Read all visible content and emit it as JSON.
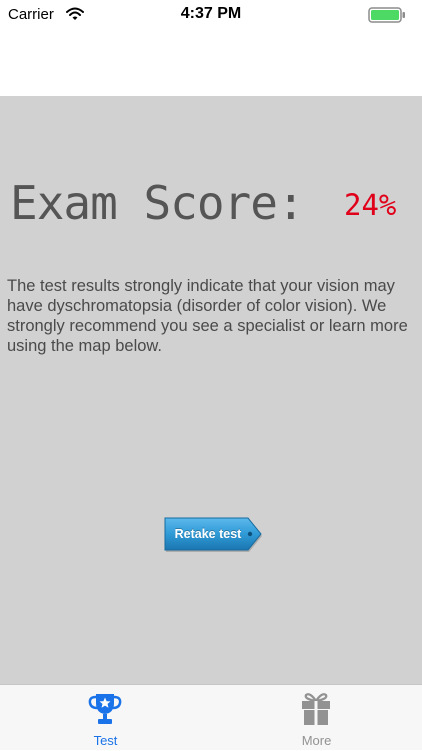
{
  "status_bar": {
    "carrier": "Carrier",
    "time": "4:37 PM"
  },
  "exam": {
    "title": "Exam Score:",
    "score": "24%",
    "result_text": "The test results strongly indicate that your vision may have dyschromatopsia (disorder of color vision). We strongly recommend you see a specialist or learn more using the map below."
  },
  "retake_button": {
    "label": "Retake test"
  },
  "tab_bar": {
    "tabs": [
      {
        "label": "Test",
        "icon": "trophy-icon",
        "active": true
      },
      {
        "label": "More",
        "icon": "gift-icon",
        "active": false
      }
    ]
  },
  "colors": {
    "background": "#d1d1d1",
    "score": "#e0001a",
    "accent": "#1a73e8",
    "button": "#2f9ad6",
    "battery": "#4cd964",
    "inactive": "#929292"
  }
}
